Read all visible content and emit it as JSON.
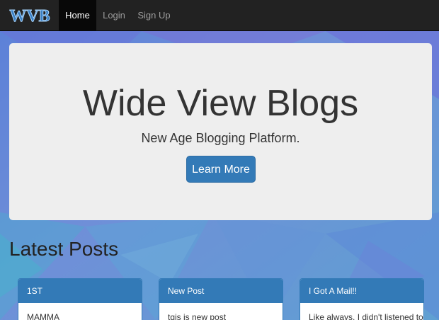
{
  "navbar": {
    "brand": "WVB",
    "items": [
      {
        "label": "Home",
        "active": true
      },
      {
        "label": "Login",
        "active": false
      },
      {
        "label": "Sign Up",
        "active": false
      }
    ]
  },
  "hero": {
    "title": "Wide View Blogs",
    "subtitle": "New Age Blogging Platform.",
    "button_label": "Learn More"
  },
  "latest": {
    "heading": "Latest Posts",
    "posts": [
      {
        "title": "1ST",
        "excerpt": "MAMMA"
      },
      {
        "title": "New Post",
        "excerpt": "tgis is new post"
      },
      {
        "title": "I Got A Mail!!",
        "excerpt": "Like always, I didn't listened to"
      }
    ]
  },
  "colors": {
    "navbar": "#222222",
    "primary": "#337ab7",
    "jumbotron": "#eeeeee",
    "background_blue": "#6aa0d6",
    "background_purple": "#7a6fd6"
  }
}
